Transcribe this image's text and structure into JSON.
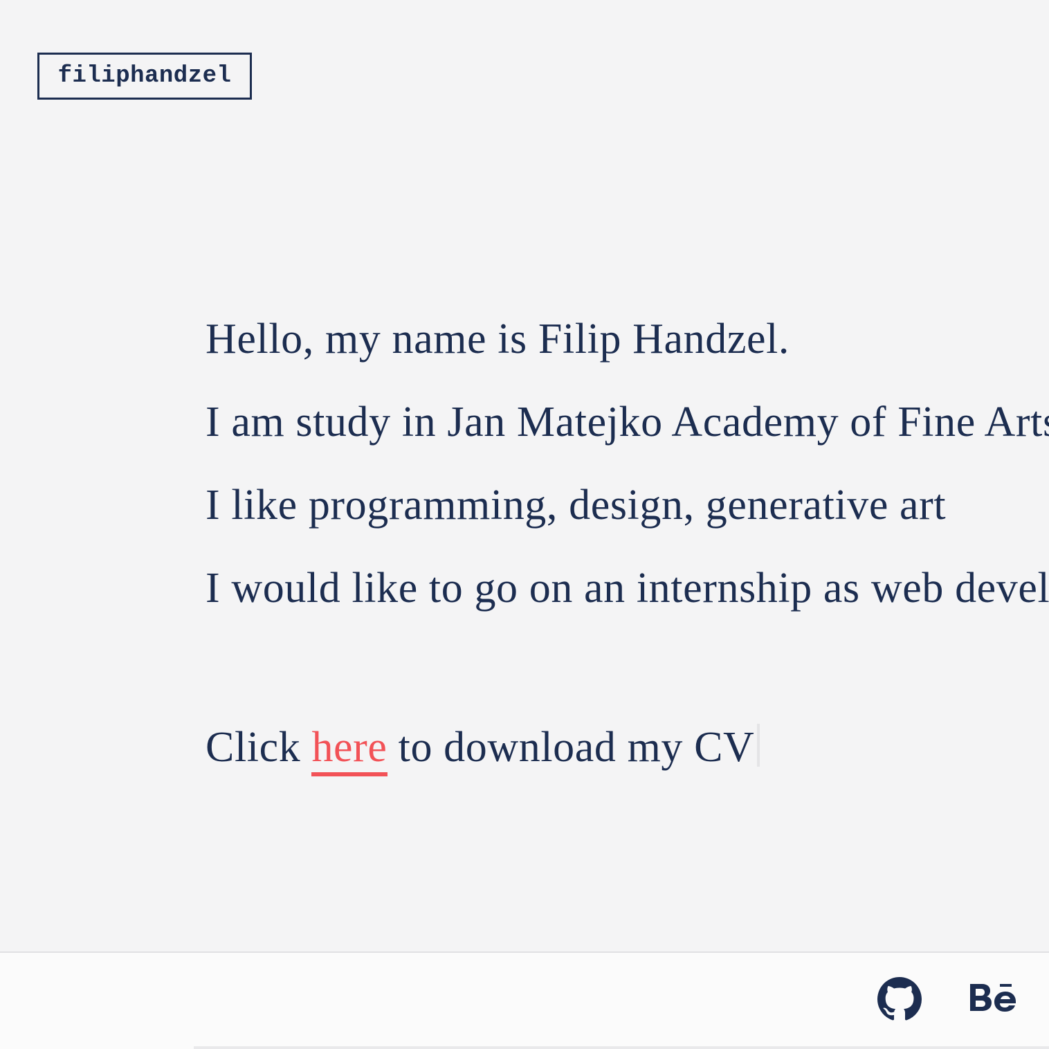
{
  "header": {
    "logo_text": "filiphandzel"
  },
  "intro": {
    "lines": [
      "Hello, my name is Filip Handzel.",
      "I am study in Jan Matejko Academy of Fine Arts",
      "I like programming, design, generative art",
      "I would like to go on an internship as web developer"
    ]
  },
  "cv": {
    "prefix": "Click ",
    "link_text": "here",
    "suffix": " to download my CV"
  },
  "footer": {
    "icons": [
      "github-icon",
      "behance-icon"
    ]
  },
  "colors": {
    "text": "#1c2d50",
    "accent": "#f25257",
    "background": "#f4f4f5",
    "footer_background": "#fbfbfb"
  }
}
